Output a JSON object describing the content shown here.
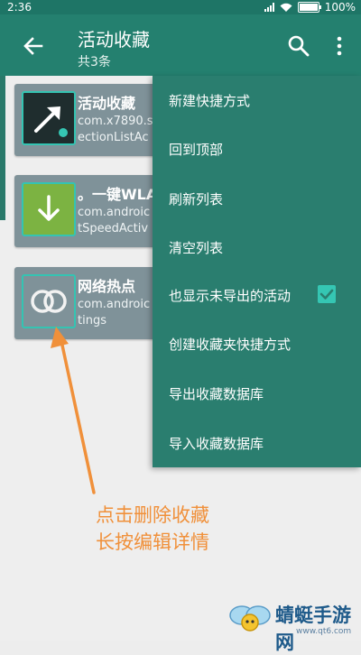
{
  "status_bar": {
    "time": "2:36",
    "battery": "100%"
  },
  "app_bar": {
    "title": "活动收藏",
    "subtitle": "共3条"
  },
  "cards": [
    {
      "name": "活动收藏",
      "pkg_line1": "com.x7890.s",
      "pkg_line2": "ectionListAc",
      "icon": "arrow-shortcut-icon"
    },
    {
      "name": "。一键WLA",
      "pkg_line1": "com.androic",
      "pkg_line2": "tSpeedActiv",
      "icon": "download-icon"
    },
    {
      "name": "网络热点",
      "pkg_line1": "com.androic",
      "pkg_line2": "tings",
      "icon": "hotspot-rings-icon"
    }
  ],
  "menu": {
    "items": [
      "新建快捷方式",
      "回到顶部",
      "刷新列表",
      "清空列表",
      "也显示未导出的活动",
      "创建收藏夹快捷方式",
      "导出收藏数据库",
      "导入收藏数据库"
    ],
    "show_unexported_checked": true
  },
  "annotation": {
    "line1": "点击删除收藏",
    "line2": "长按编辑详情"
  },
  "watermark": {
    "brand": "蜻蜓手游网",
    "url": "www.qt6.com"
  },
  "colors": {
    "primary": "#24806f",
    "status_bar": "#1e7566",
    "menu": "#2a7e6f",
    "card": "#7f9299",
    "accent": "#35c6b3",
    "annotation": "#f0903a"
  }
}
